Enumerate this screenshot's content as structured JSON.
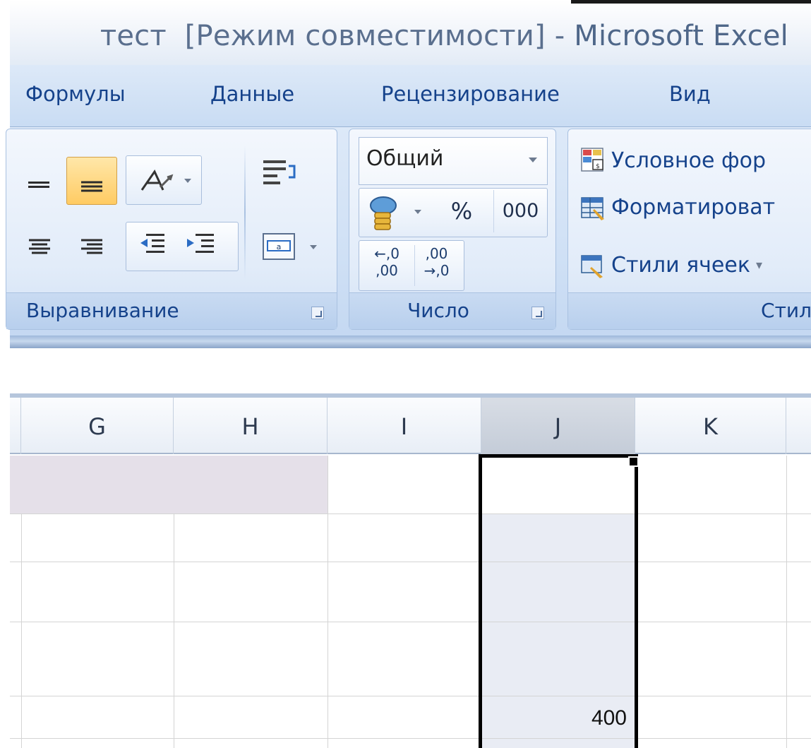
{
  "window": {
    "title_file": "тест",
    "title_mode": "[Режим совместимости]",
    "title_sep": "-",
    "title_app": "Microsoft Excel"
  },
  "ribbon_tabs": [
    {
      "label": "Формулы"
    },
    {
      "label": "Данные"
    },
    {
      "label": "Рецензирование"
    },
    {
      "label": "Вид"
    }
  ],
  "groups": {
    "alignment": {
      "label": "Выравнивание"
    },
    "number": {
      "label": "Число",
      "format_value": "Общий",
      "percent": "%",
      "thousands": "000",
      "inc_decimal": "←,0 ,00",
      "dec_decimal": ",00 →,0"
    },
    "styles": {
      "label": "Стил",
      "conditional": "Условное фор",
      "format_table": "Форматироват",
      "cell_styles": "Стили ячеек"
    }
  },
  "sheet": {
    "columns": [
      "G",
      "H",
      "I",
      "J",
      "K"
    ],
    "selected_column": "J",
    "cell_value": "400"
  },
  "colors": {
    "selection_fill": "#e9ecf4",
    "merged_fill": "#e5e0e9",
    "active_button": "#ffcb63"
  }
}
